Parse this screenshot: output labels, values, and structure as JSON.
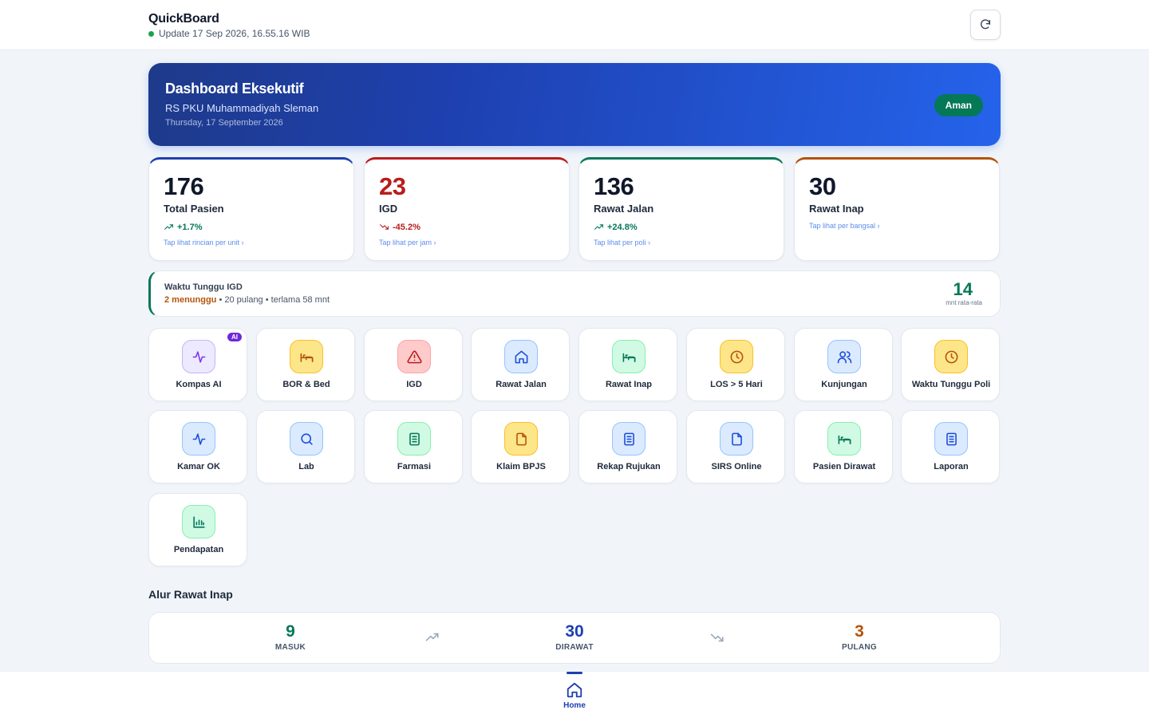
{
  "header": {
    "app_title": "QuickBoard",
    "update_text": "Update 17 Sep 2026, 16.55.16 WIB",
    "refresh_icon": "refresh-icon"
  },
  "hero": {
    "title": "Dashboard Eksekutif",
    "hospital": "RS PKU Muhammadiyah Sleman",
    "date": "Thursday, 17 September 2026",
    "status_badge": "Aman"
  },
  "kpis": [
    {
      "value": "176",
      "label": "Total Pasien",
      "change": "+1.7%",
      "trend": "up",
      "tap": "Tap lihat rincian per unit ›",
      "accent": "#1e40af",
      "value_color": "#0f172a",
      "change_color": "#047857"
    },
    {
      "value": "23",
      "label": "IGD",
      "change": "-45.2%",
      "trend": "down",
      "tap": "Tap lihat per jam ›",
      "accent": "#b91c1c",
      "value_color": "#b91c1c",
      "change_color": "#b91c1c"
    },
    {
      "value": "136",
      "label": "Rawat Jalan",
      "change": "+24.8%",
      "trend": "up",
      "tap": "Tap lihat per poli ›",
      "accent": "#047857",
      "value_color": "#0f172a",
      "change_color": "#047857"
    },
    {
      "value": "30",
      "label": "Rawat Inap",
      "change": "",
      "trend": "",
      "tap": "Tap lihat per bangsal ›",
      "accent": "#b45309",
      "value_color": "#0f172a",
      "change_color": "#047857"
    }
  ],
  "wait_igd": {
    "title": "Waktu Tunggu IGD",
    "waiting": "2 menunggu",
    "rest": " • 20 pulang • terlama 58 mnt",
    "value": "14",
    "unit": "mnt rata-rata"
  },
  "menu": [
    {
      "label": "Kompas AI",
      "icon": "activity-icon",
      "color": "#7c3aed",
      "bg": "#ede9fe",
      "border": "#c4b5fd",
      "badge": "AI"
    },
    {
      "label": "BOR & Bed",
      "icon": "bed-icon",
      "color": "#b45309",
      "bg": "#fde68a",
      "border": "#fbbf24"
    },
    {
      "label": "IGD",
      "icon": "alert-triangle-icon",
      "color": "#b91c1c",
      "bg": "#fecaca",
      "border": "#fca5a5"
    },
    {
      "label": "Rawat Jalan",
      "icon": "home-icon",
      "color": "#1d4ed8",
      "bg": "#dbeafe",
      "border": "#93c5fd"
    },
    {
      "label": "Rawat Inap",
      "icon": "bed-icon",
      "color": "#047857",
      "bg": "#d1fae5",
      "border": "#86efac"
    },
    {
      "label": "LOS > 5 Hari",
      "icon": "clock-icon",
      "color": "#b45309",
      "bg": "#fde68a",
      "border": "#fbbf24"
    },
    {
      "label": "Kunjungan",
      "icon": "users-icon",
      "color": "#1d4ed8",
      "bg": "#dbeafe",
      "border": "#93c5fd"
    },
    {
      "label": "Waktu Tunggu Poli",
      "icon": "clock-icon",
      "color": "#b45309",
      "bg": "#fde68a",
      "border": "#fbbf24"
    },
    {
      "label": "Kamar OK",
      "icon": "activity-icon",
      "color": "#1d4ed8",
      "bg": "#dbeafe",
      "border": "#93c5fd"
    },
    {
      "label": "Lab",
      "icon": "search-icon",
      "color": "#1d4ed8",
      "bg": "#dbeafe",
      "border": "#93c5fd"
    },
    {
      "label": "Farmasi",
      "icon": "document-lines-icon",
      "color": "#047857",
      "bg": "#d1fae5",
      "border": "#86efac"
    },
    {
      "label": "Klaim BPJS",
      "icon": "file-icon",
      "color": "#b45309",
      "bg": "#fde68a",
      "border": "#fbbf24"
    },
    {
      "label": "Rekap Rujukan",
      "icon": "document-lines-icon",
      "color": "#1d4ed8",
      "bg": "#dbeafe",
      "border": "#93c5fd"
    },
    {
      "label": "SIRS Online",
      "icon": "file-icon",
      "color": "#1d4ed8",
      "bg": "#dbeafe",
      "border": "#93c5fd"
    },
    {
      "label": "Pasien Dirawat",
      "icon": "bed-icon",
      "color": "#047857",
      "bg": "#d1fae5",
      "border": "#86efac"
    },
    {
      "label": "Laporan",
      "icon": "document-lines-icon",
      "color": "#1d4ed8",
      "bg": "#dbeafe",
      "border": "#93c5fd"
    },
    {
      "label": "Pendapatan",
      "icon": "bar-chart-icon",
      "color": "#047857",
      "bg": "#d1fae5",
      "border": "#86efac"
    }
  ],
  "flow": {
    "title": "Alur Rawat Inap",
    "masuk": {
      "value": "9",
      "label": "MASUK",
      "color": "#047857"
    },
    "dirawat": {
      "value": "30",
      "label": "DIRAWAT",
      "color": "#1e40af"
    },
    "pulang": {
      "value": "3",
      "label": "PULANG",
      "color": "#b45309"
    }
  },
  "bottom_nav": {
    "home_label": "Home"
  }
}
